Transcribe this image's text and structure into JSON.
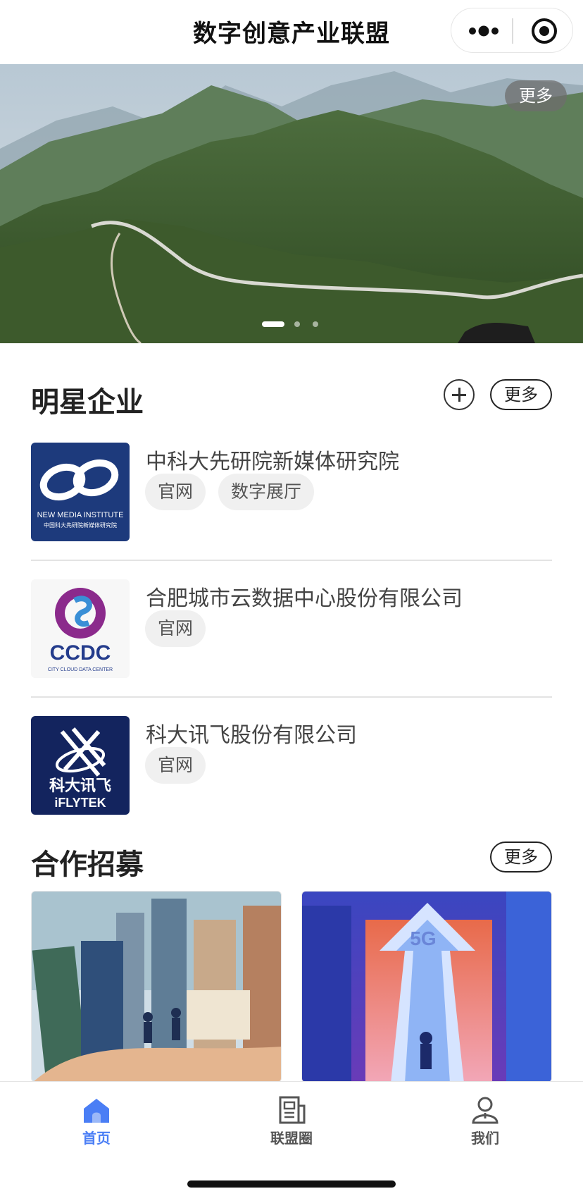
{
  "header": {
    "title": "数字创意产业联盟",
    "menu_icon": "more-dots-icon",
    "close_icon": "target-circle-icon"
  },
  "banner": {
    "more_label": "更多",
    "slide_count": 3,
    "active_slide": 0
  },
  "star_enterprises": {
    "title": "明星企业",
    "more_label": "更多",
    "items": [
      {
        "name": "中科大先研院新媒体研究院",
        "tags": [
          "官网",
          "数字展厅"
        ],
        "logo_text": "NEW MEDIA INSTITUTE",
        "logo_subtext": "中国科大先研院新媒体研究院",
        "logo_color": "#1d3a7c"
      },
      {
        "name": "合肥城市云数据中心股份有限公司",
        "tags": [
          "官网"
        ],
        "logo_text": "CCDC",
        "logo_subtext": "CITY CLOUD DATA CENTER",
        "logo_color": "#2b3a8c"
      },
      {
        "name": "科大讯飞股份有限公司",
        "tags": [
          "官网"
        ],
        "logo_text": "科大讯飞",
        "logo_subtext": "iFLYTEK",
        "logo_color": "#13245e"
      }
    ]
  },
  "cooperation": {
    "title": "合作招募",
    "more_label": "更多",
    "card2_text": "5G"
  },
  "tabbar": {
    "active_color": "#4a7ef5",
    "inactive_color": "#555555",
    "items": [
      {
        "label": "首页",
        "icon": "home-icon",
        "active": true
      },
      {
        "label": "联盟圈",
        "icon": "document-icon",
        "active": false
      },
      {
        "label": "我们",
        "icon": "person-icon",
        "active": false
      }
    ]
  }
}
